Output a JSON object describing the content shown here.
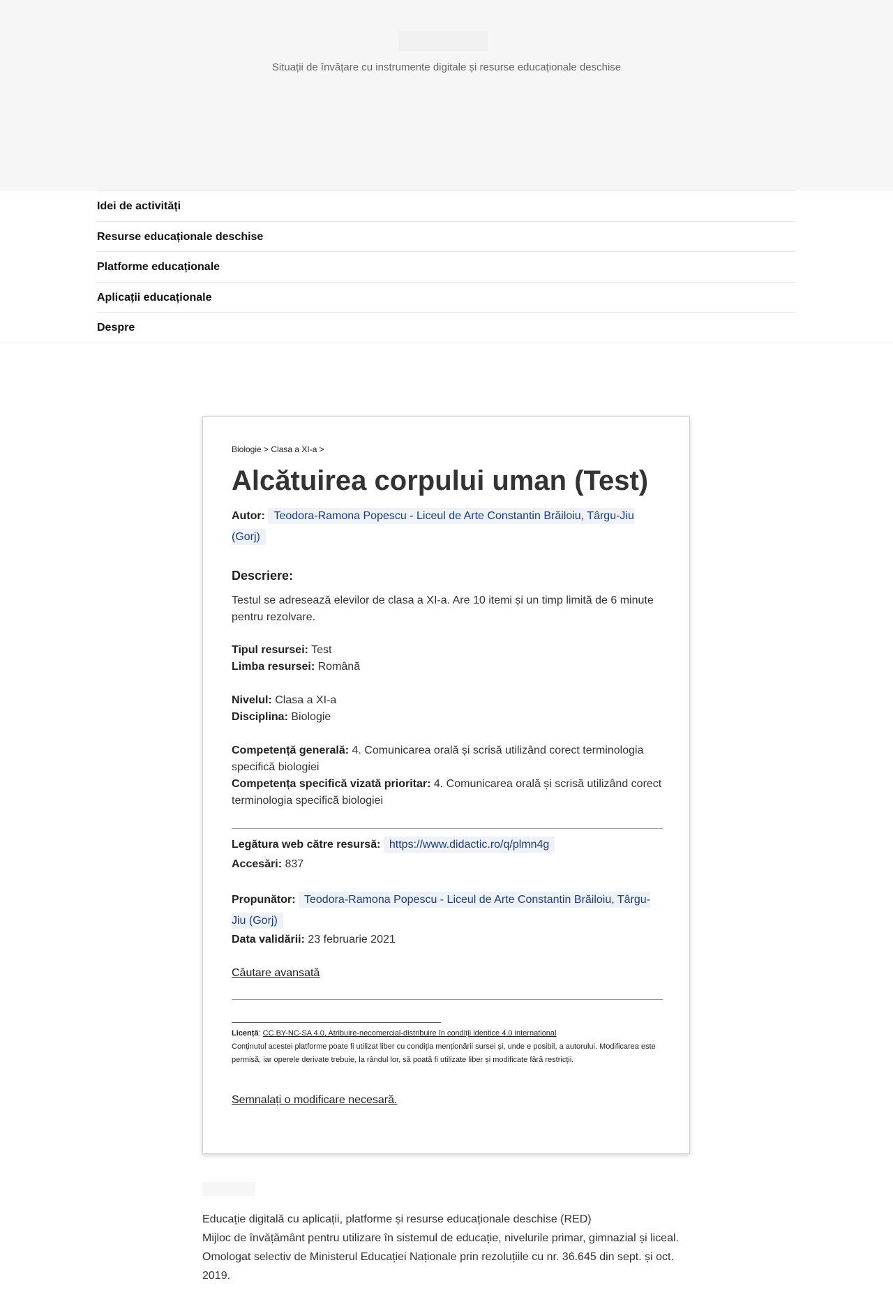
{
  "header": {
    "tagline": "Situații de învățare cu instrumente digitale și resurse educaționale deschise"
  },
  "nav": {
    "items": [
      {
        "label": "Idei de activități"
      },
      {
        "label": "Resurse educaționale deschise"
      },
      {
        "label": "Platforme educaționale"
      },
      {
        "label": "Aplicații educaționale"
      },
      {
        "label": "Despre"
      }
    ]
  },
  "resource": {
    "breadcrumb": {
      "subject": "Biologie",
      "separator1": " > ",
      "grade": "Clasa a XI-a",
      "separator2": " >"
    },
    "title": "Alcătuirea corpului uman (Test)",
    "author_label": "Autor:",
    "author": "Teodora-Ramona Popescu - Liceul de Arte Constantin Brăiloiu, Târgu-Jiu (Gorj)",
    "description_heading": "Descriere:",
    "description": "Testul se adresează elevilor de clasa a XI-a. Are 10 itemi și un timp limită de 6 minute pentru rezolvare.",
    "type_label": "Tipul resursei:",
    "type": "Test",
    "language_label": "Limba resursei:",
    "language": "Română",
    "level_label": "Nivelul:",
    "level": "Clasa a XI-a",
    "discipline_label": "Disciplina:",
    "discipline": "Biologie",
    "general_competence_label": "Competență generală:",
    "general_competence": "4. Comunicarea orală și scrisă utilizând corect terminologia specifică biologiei",
    "specific_competence_label": "Competența specifică vizată prioritar:",
    "specific_competence": "4. Comunicarea orală și scrisă utilizând corect terminologia specifică biologiei",
    "web_link_label": "Legătura web către resursă:",
    "web_link": "https://www.didactic.ro/q/plmn4g",
    "access_label": "Accesări:",
    "access_count": "837",
    "proposer_label": "Propunător:",
    "proposer": "Teodora-Ramona Popescu - Liceul de Arte Constantin Brăiloiu, Târgu-Jiu (Gorj)",
    "validation_label": "Data validării:",
    "validation_date": "23 februarie 2021",
    "advanced_search": "Căutare avansată",
    "license_label": "Licență",
    "license_sep": ": ",
    "license_link": "CC BY-NC-SA 4.0, Atribuire-necomercial-distribuire în condiții identice 4.0 international",
    "license_text": "Conținutul acestei platforme poate fi utilizat liber cu condiția menționării sursei și, unde e posibil, a autorului. Modificarea este permisă, iar operele derivate trebuie, la rândul lor, să poată fi utilizate liber și modificate fără restricții.",
    "report_link": "Semnalați o modificare necesară."
  },
  "footer": {
    "line1": "Educație digitală cu aplicații, platforme și resurse educaționale deschise (RED)",
    "line2": "Mijloc de învățământ pentru utilizare în sistemul de educație, nivelurile primar, gimnazial și liceal.",
    "line3": "Omologat selectiv de Ministerul Educației Naționale prin rezoluțiile cu nr. 36.645 din sept. și oct. 2019."
  }
}
